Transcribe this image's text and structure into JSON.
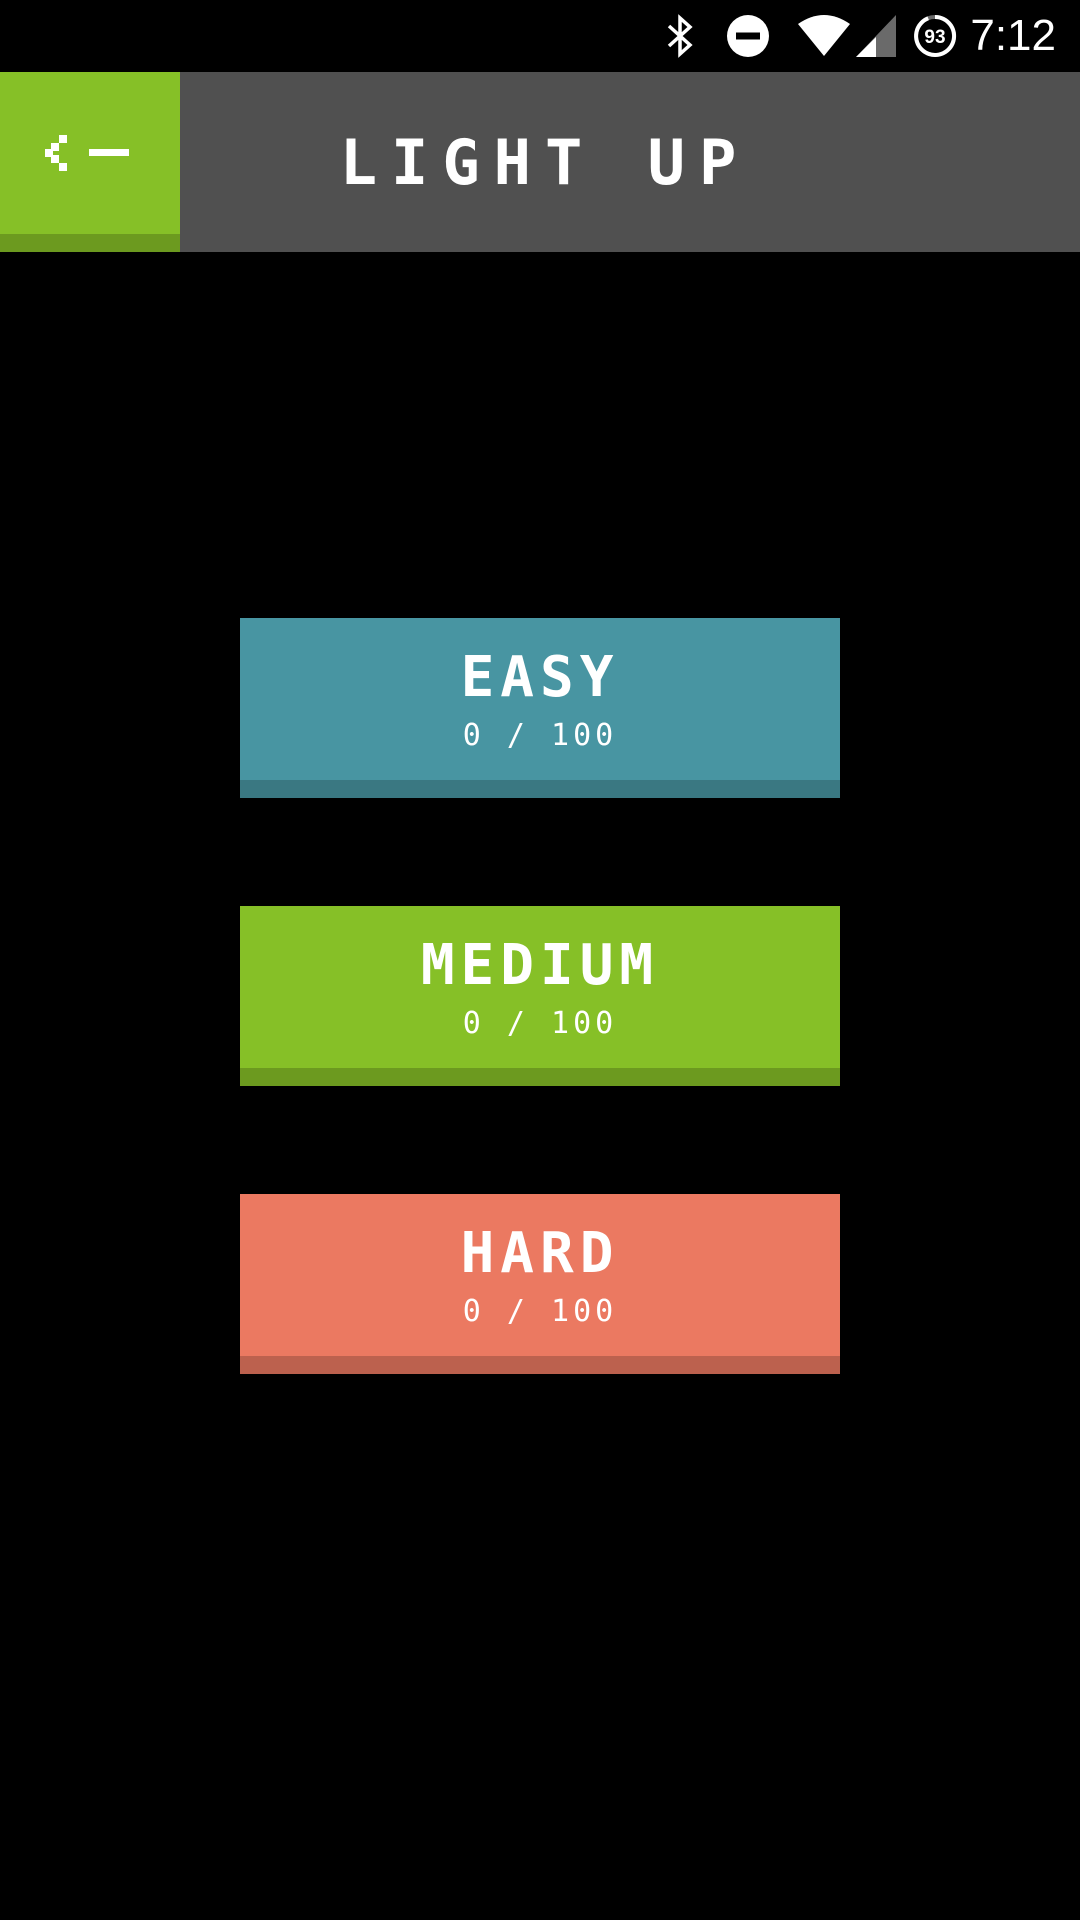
{
  "status_bar": {
    "time": "7:12",
    "battery_level": "93",
    "icons": [
      "bluetooth-icon",
      "do-not-disturb-icon",
      "wifi-icon",
      "cellular-signal-icon",
      "battery-icon"
    ]
  },
  "app_bar": {
    "back_label": "<-",
    "title": "LIGHT UP",
    "colors": {
      "bar": "#505050",
      "back": "#86c027"
    }
  },
  "levels": [
    {
      "label": "EASY",
      "progress": "0 / 100",
      "completed": 0,
      "total": 100,
      "color": "#4895a2"
    },
    {
      "label": "MEDIUM",
      "progress": "0 / 100",
      "completed": 0,
      "total": 100,
      "color": "#86c027"
    },
    {
      "label": "HARD",
      "progress": "0 / 100",
      "completed": 0,
      "total": 100,
      "color": "#eb7961"
    }
  ]
}
